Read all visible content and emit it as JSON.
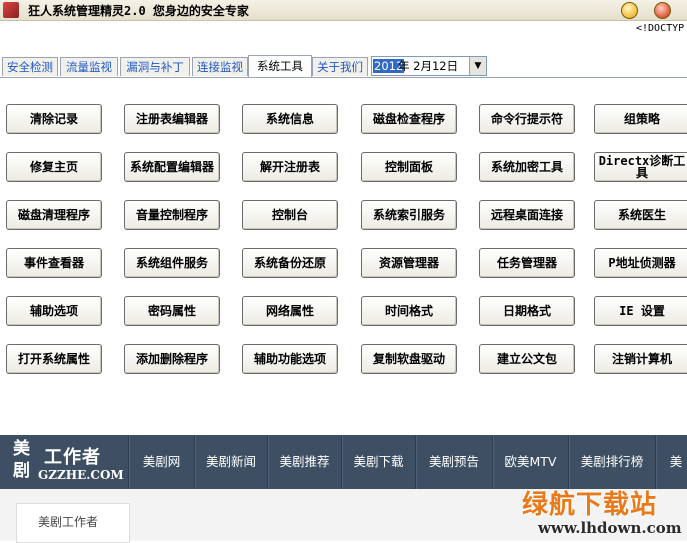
{
  "window": {
    "title": "狂人系统管理精灵2.0 您身边的安全专家",
    "doctype_fragment": "<!DOCTYP"
  },
  "tabs": [
    {
      "label": "安全检测"
    },
    {
      "label": "流量监视"
    },
    {
      "label": "漏洞与补丁"
    },
    {
      "label": "连接监视"
    },
    {
      "label": "系统工具"
    },
    {
      "label": "关于我们"
    }
  ],
  "active_tab": "系统工具",
  "date_picker": {
    "selected_part": "2012",
    "rest": "年  2月12日"
  },
  "tools": [
    [
      "清除记录",
      "注册表编辑器",
      "系统信息",
      "磁盘检查程序",
      "命令行提示符",
      "组策略"
    ],
    [
      "修复主页",
      "系统配置编辑器",
      "解开注册表",
      "控制面板",
      "系统加密工具",
      "Directx诊断工具"
    ],
    [
      "磁盘清理程序",
      "音量控制程序",
      "控制台",
      "系统索引服务",
      "远程桌面连接",
      "系统医生"
    ],
    [
      "事件查看器",
      "系统组件服务",
      "系统备份还原",
      "资源管理器",
      "任务管理器",
      "P地址侦测器"
    ],
    [
      "辅助选项",
      "密码属性",
      "网络属性",
      "时间格式",
      "日期格式",
      "IE 设置"
    ],
    [
      "打开系统属性",
      "添加删除程序",
      "辅助功能选项",
      "复制软盘驱动",
      "建立公文包",
      "注销计算机"
    ]
  ],
  "website": {
    "logo_line1": "美",
    "logo_line2": "剧",
    "logo_name": "工作者",
    "logo_url": "GZZHE.COM",
    "nav": [
      "美剧网",
      "美剧新闻",
      "美剧推荐",
      "美剧下载",
      "美剧预告",
      "欧美MTV",
      "美剧排行榜",
      "美"
    ],
    "sub_label": "美剧工作者",
    "bg_color": "#3e4f63"
  },
  "watermark": {
    "title": "绿航下载站",
    "url": "www.lhdown.com"
  }
}
